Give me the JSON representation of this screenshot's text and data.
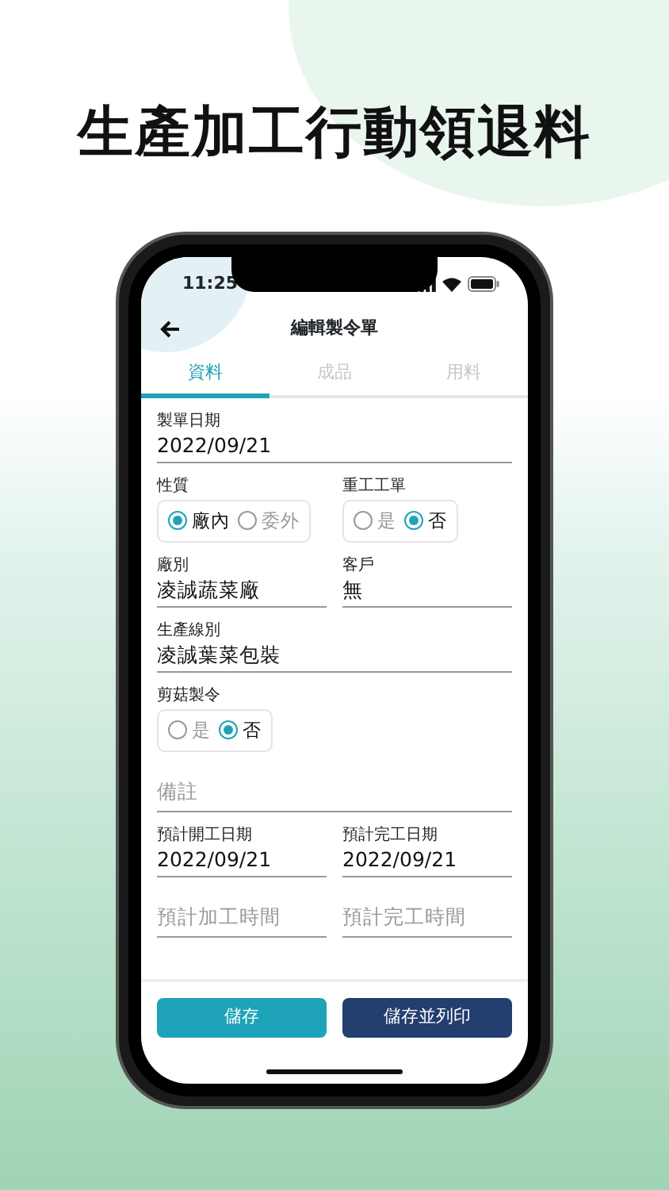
{
  "headline": "生產加工行動領退料",
  "status_bar": {
    "time": "11:25"
  },
  "header": {
    "title": "編輯製令單"
  },
  "tabs": [
    {
      "label": "資料",
      "selected": true
    },
    {
      "label": "成品",
      "selected": false
    },
    {
      "label": "用料",
      "selected": false
    }
  ],
  "form_rows": [
    {
      "fields": [
        {
          "kind": "text",
          "label": "製單日期",
          "value": "2022/09/21"
        }
      ]
    },
    {
      "fields": [
        {
          "kind": "radio",
          "label": "性質",
          "options": [
            {
              "label": "廠內",
              "selected": true
            },
            {
              "label": "委外",
              "selected": false
            }
          ]
        },
        {
          "kind": "radio",
          "label": "重工工單",
          "options": [
            {
              "label": "是",
              "selected": false
            },
            {
              "label": "否",
              "selected": true
            }
          ]
        }
      ]
    },
    {
      "fields": [
        {
          "kind": "text",
          "label": "廠別",
          "value": "凌誠蔬菜廠"
        },
        {
          "kind": "text",
          "label": "客戶",
          "value": "無"
        }
      ]
    },
    {
      "fields": [
        {
          "kind": "text",
          "label": "生產線別",
          "value": "凌誠葉菜包裝"
        }
      ]
    },
    {
      "fields": [
        {
          "kind": "radio",
          "label": "剪菇製令",
          "options": [
            {
              "label": "是",
              "selected": false
            },
            {
              "label": "否",
              "selected": true
            }
          ]
        },
        {
          "kind": "empty"
        }
      ]
    },
    {
      "fields": [
        {
          "kind": "input",
          "placeholder": "備註"
        }
      ]
    },
    {
      "fields": [
        {
          "kind": "text",
          "label": "預計開工日期",
          "value": "2022/09/21"
        },
        {
          "kind": "text",
          "label": "預計完工日期",
          "value": "2022/09/21"
        }
      ]
    },
    {
      "fields": [
        {
          "kind": "input",
          "placeholder": "預計加工時間"
        },
        {
          "kind": "input",
          "placeholder": "預計完工時間"
        }
      ]
    }
  ],
  "buttons": [
    {
      "label": "儲存",
      "kind": "primary"
    },
    {
      "label": "儲存並列印",
      "kind": "secondary"
    }
  ]
}
